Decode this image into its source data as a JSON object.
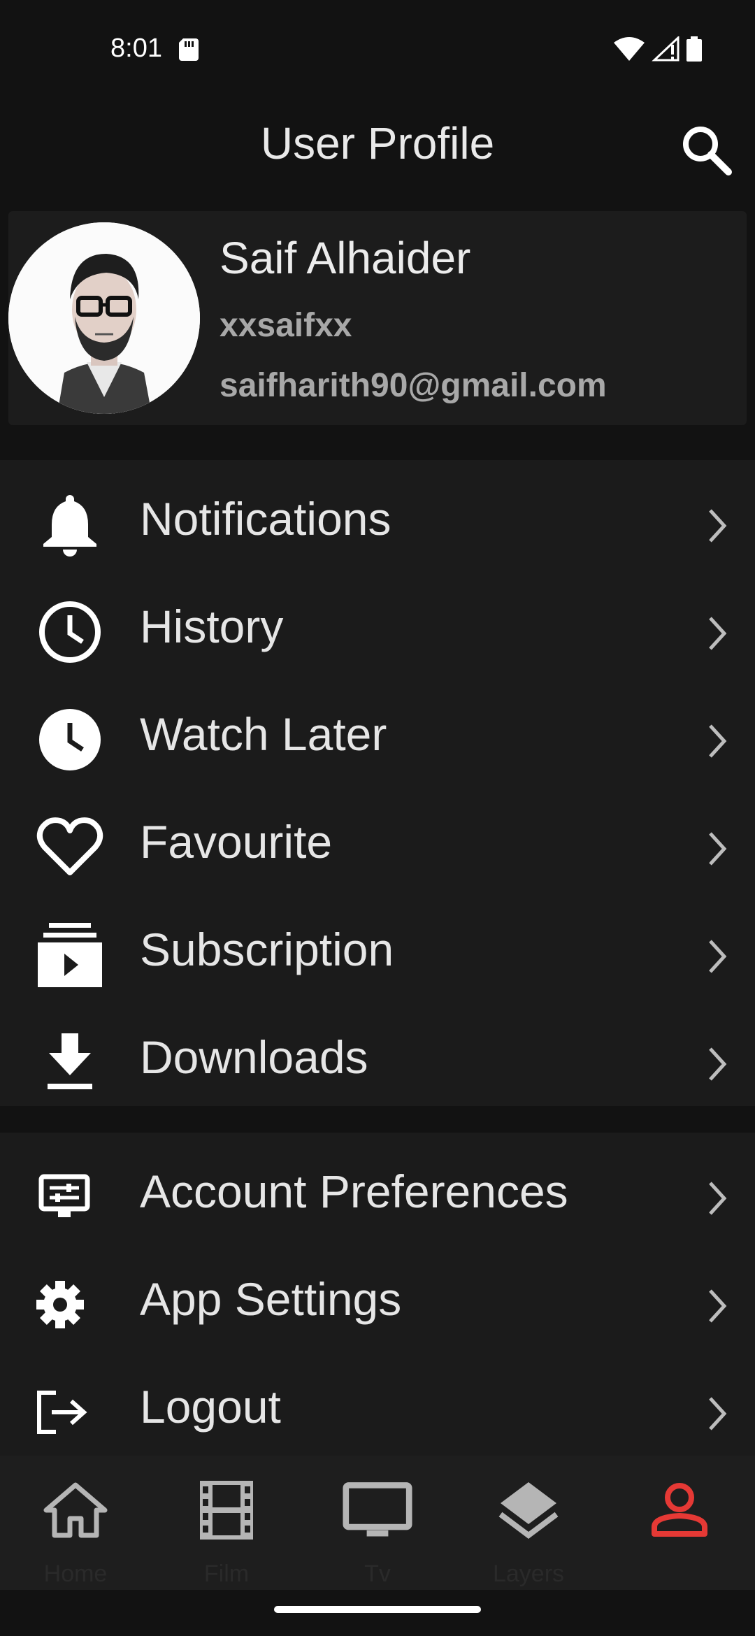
{
  "status_bar": {
    "time": "8:01"
  },
  "app_bar": {
    "title": "User Profile"
  },
  "profile": {
    "name": "Saif Alhaider",
    "username": "xxsaifxx",
    "email": "saifharith90@gmail.com"
  },
  "menu": {
    "group1": [
      {
        "label": "Notifications",
        "icon": "bell-icon"
      },
      {
        "label": "History",
        "icon": "clock-outline-icon"
      },
      {
        "label": "Watch Later",
        "icon": "clock-filled-icon"
      },
      {
        "label": "Favourite",
        "icon": "heart-outline-icon"
      },
      {
        "label": "Subscription",
        "icon": "subscription-icon"
      },
      {
        "label": "Downloads",
        "icon": "download-icon"
      }
    ],
    "group2": [
      {
        "label": "Account Preferences",
        "icon": "preferences-icon"
      },
      {
        "label": "App Settings",
        "icon": "gear-icon"
      },
      {
        "label": "Logout",
        "icon": "logout-icon"
      }
    ]
  },
  "bottom_nav": {
    "items": [
      {
        "label": "Home",
        "icon": "home-icon"
      },
      {
        "label": "Film",
        "icon": "film-icon"
      },
      {
        "label": "Tv",
        "icon": "tv-icon"
      },
      {
        "label": "Layers",
        "icon": "layers-icon"
      },
      {
        "label": "",
        "icon": "person-icon"
      }
    ],
    "active_index": 4
  },
  "colors": {
    "background": "#121212",
    "surface": "#1b1b1b",
    "accent": "#e53935",
    "text": "#e6e6e6",
    "muted_text": "#a8a8a8"
  }
}
